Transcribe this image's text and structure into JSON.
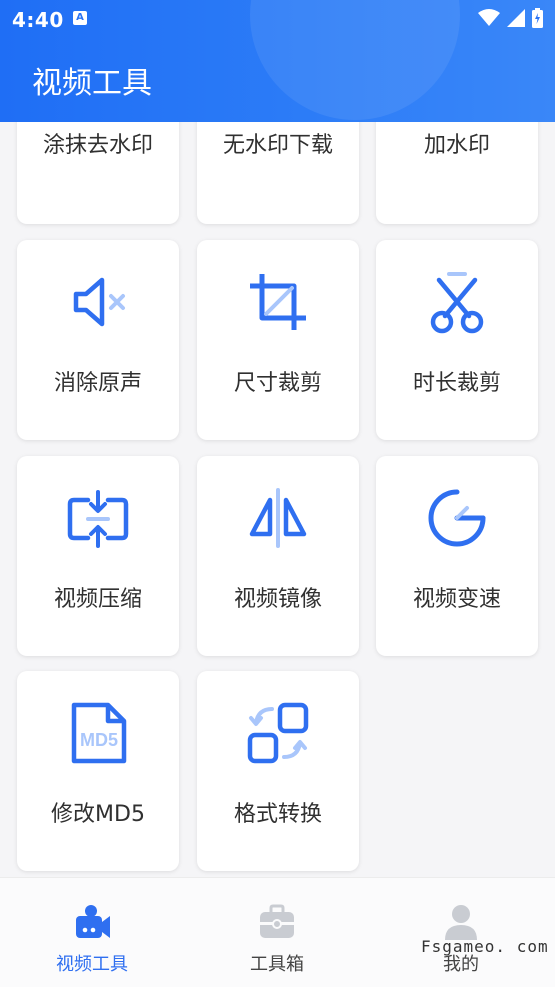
{
  "status_bar": {
    "time": "4:40"
  },
  "app_bar": {
    "title": "视频工具"
  },
  "tools": [
    {
      "label": "涂抹去水印",
      "icon": "erase-watermark-icon"
    },
    {
      "label": "无水印下载",
      "icon": "download-icon"
    },
    {
      "label": "加水印",
      "icon": "add-watermark-icon"
    },
    {
      "label": "消除原声",
      "icon": "mute-icon"
    },
    {
      "label": "尺寸裁剪",
      "icon": "crop-icon"
    },
    {
      "label": "时长裁剪",
      "icon": "scissors-icon"
    },
    {
      "label": "视频压缩",
      "icon": "compress-icon"
    },
    {
      "label": "视频镜像",
      "icon": "mirror-icon"
    },
    {
      "label": "视频变速",
      "icon": "speed-gauge-icon"
    },
    {
      "label": "修改MD5",
      "icon": "md5-file-icon",
      "icon_text": "MD5"
    },
    {
      "label": "格式转换",
      "icon": "format-convert-icon"
    }
  ],
  "bottom_nav": [
    {
      "label": "视频工具",
      "icon": "video-camera-icon",
      "active": true
    },
    {
      "label": "工具箱",
      "icon": "toolbox-icon",
      "active": false
    },
    {
      "label": "我的",
      "icon": "person-icon",
      "active": false
    }
  ],
  "colors": {
    "primary": "#2f6ff0",
    "primary_light": "#a9c6fb",
    "inactive": "#c9ccd2",
    "active_text": "#2f6ff0"
  },
  "watermark": "Fsgameo. com"
}
